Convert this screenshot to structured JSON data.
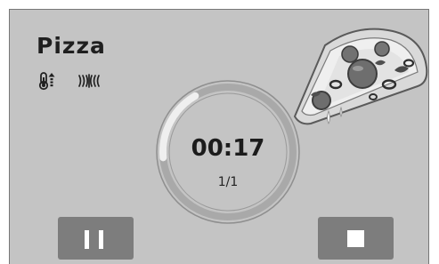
{
  "header": {
    "title": "Pizza"
  },
  "icons": {
    "temperature": "thermometer-up-icon",
    "mode": "radiant-heat-icon"
  },
  "timer": {
    "time": "00:17",
    "step": "1/1",
    "progress_fraction": 0.18
  },
  "controls": {
    "pause": "pause-icon",
    "stop": "stop-icon"
  },
  "colors": {
    "panel": "#c4c4c4",
    "button": "#7d7d7d",
    "ring_track": "#a9a9a9",
    "ring_progress": "#efefef"
  }
}
